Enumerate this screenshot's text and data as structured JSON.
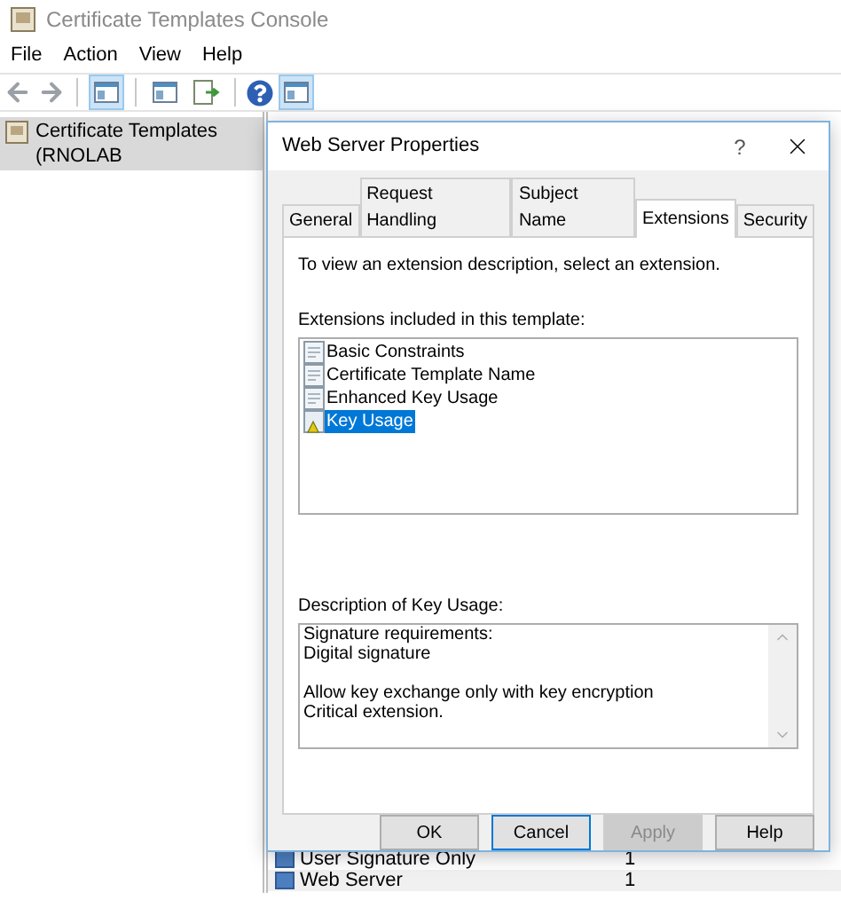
{
  "window": {
    "title": "Certificate Templates Console"
  },
  "menu": [
    "File",
    "Action",
    "View",
    "Help"
  ],
  "tree": {
    "items": [
      {
        "label": "Certificate Templates (RNOLAB",
        "selected": true
      }
    ]
  },
  "list": {
    "rows": [
      {
        "name": "User Signature Only",
        "column_2": "1"
      },
      {
        "name": "Web Server",
        "column_2": "1"
      }
    ]
  },
  "dialog": {
    "title": "Web Server Properties",
    "help": "?",
    "tabs": [
      {
        "label": "General",
        "selected": false
      },
      {
        "label": "Request Handling",
        "selected": false
      },
      {
        "label": "Subject Name",
        "selected": false
      },
      {
        "label": "Extensions",
        "selected": true
      },
      {
        "label": "Security",
        "selected": false
      }
    ],
    "instruction": "To view an extension description, select an extension.",
    "extensions_label": "Extensions included in this template:",
    "extensions": [
      {
        "label": "Basic Constraints",
        "kind": "standard",
        "selected": false
      },
      {
        "label": "Certificate Template Name",
        "kind": "standard",
        "selected": false
      },
      {
        "label": "Enhanced Key Usage",
        "kind": "standard",
        "selected": false
      },
      {
        "label": "Key Usage",
        "kind": "critical",
        "selected": true
      }
    ],
    "description_label": "Description of Key Usage:",
    "description": "Signature requirements:\nDigital signature\n\nAllow key exchange only with key encryption\nCritical extension.",
    "buttons": [
      {
        "label": "OK",
        "disabled": false,
        "focused": false
      },
      {
        "label": "Cancel",
        "disabled": false,
        "focused": true
      },
      {
        "label": "Apply",
        "disabled": true,
        "focused": false
      },
      {
        "label": "Help",
        "disabled": false,
        "focused": false
      }
    ]
  }
}
